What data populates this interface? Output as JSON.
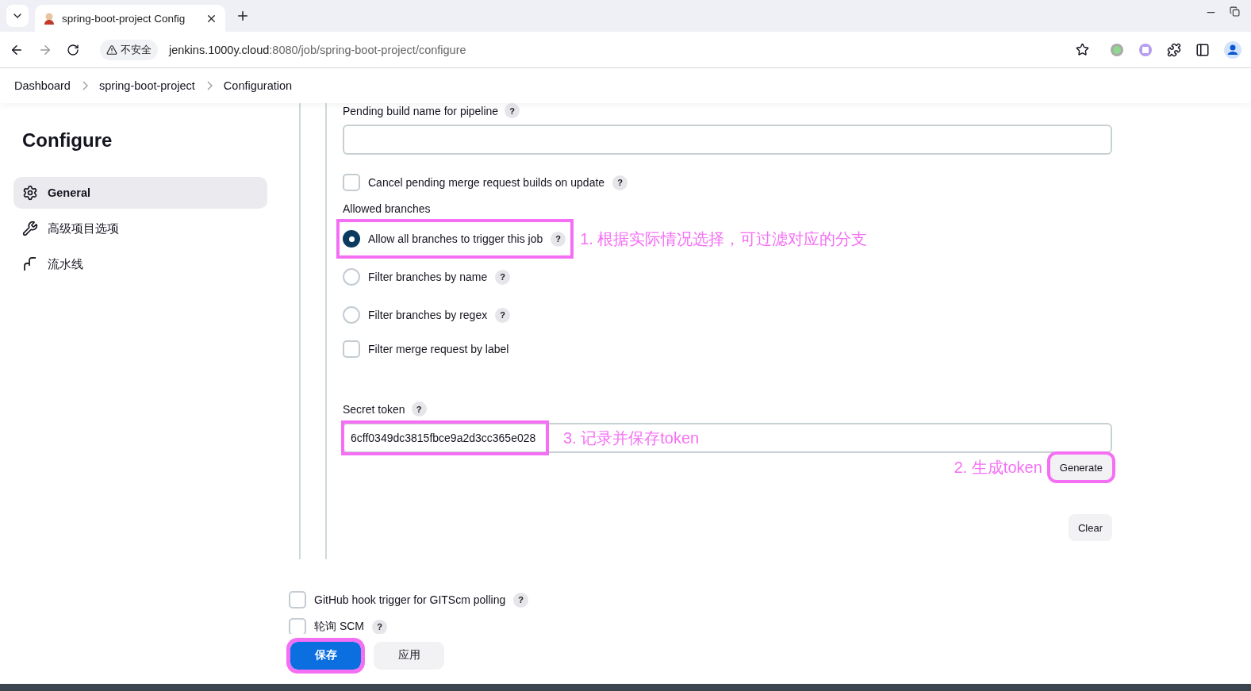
{
  "browser": {
    "tab_title": "spring-boot-project Config",
    "url_host": "jenkins.1000y.cloud",
    "url_path": ":8080/job/spring-boot-project/configure",
    "security": "不安全"
  },
  "breadcrumbs": [
    "Dashboard",
    "spring-boot-project",
    "Configuration"
  ],
  "sidebar": {
    "title": "Configure",
    "items": [
      {
        "label": "General",
        "selected": true
      },
      {
        "label": "高级项目选项",
        "selected": false
      },
      {
        "label": "流水线",
        "selected": false
      }
    ]
  },
  "form": {
    "pending_label": "Pending build name for pipeline",
    "pending_help": "?",
    "cancel": {
      "label": "Cancel pending merge request builds on update",
      "help": "?",
      "checked": false
    },
    "branches_label": "Allowed branches",
    "branch_options": [
      {
        "kind": "radio",
        "label": "Allow all branches to trigger this job",
        "help": "?",
        "selected": true,
        "highlighted": true,
        "note": "1. 根据实际情况选择，可过滤对应的分支"
      },
      {
        "kind": "radio",
        "label": "Filter branches by name",
        "help": "?",
        "selected": false,
        "highlighted": false
      },
      {
        "kind": "radio",
        "label": "Filter branches by regex",
        "help": "?",
        "selected": false,
        "highlighted": false
      },
      {
        "kind": "checkbox",
        "label": "Filter merge request by label",
        "checked": false,
        "highlighted": false
      }
    ],
    "token_label": "Secret token",
    "token_help": "?",
    "token_value": "6cff0349dc3815fbce9a2d3cc365e028",
    "token_highlighted": true,
    "token_note": "3. 记录并保存token",
    "generate": {
      "label": "Generate",
      "highlighted": true,
      "note": "2. 生成token"
    },
    "clear": "Clear"
  },
  "triggers": [
    {
      "label": "GitHub hook trigger for GITScm polling",
      "help": "?",
      "checked": false
    },
    {
      "label": "轮询 SCM",
      "help": "?",
      "checked": false
    }
  ],
  "footer": {
    "save": "保存",
    "save_highlighted": true,
    "apply": "应用"
  }
}
